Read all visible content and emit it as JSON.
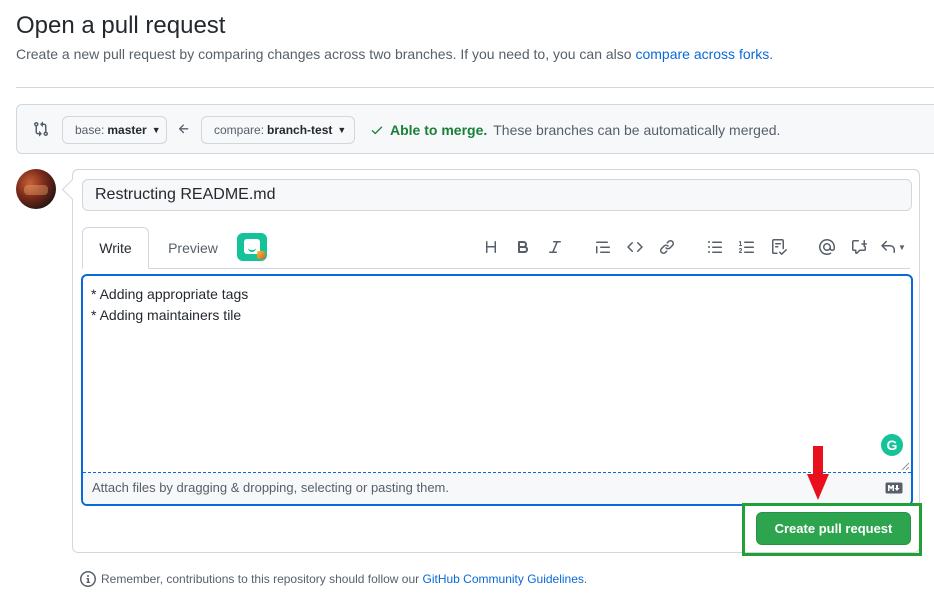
{
  "header": {
    "title": "Open a pull request",
    "subtitle": "Create a new pull request by comparing changes across two branches. If you need to, you can also ",
    "subtitle_link": "compare across forks",
    "subtitle_end": "."
  },
  "range": {
    "base_prefix": "base:",
    "base_branch": "master",
    "compare_prefix": "compare:",
    "compare_branch": "branch-test",
    "merge_ok": "Able to merge.",
    "merge_text": "These branches can be automatically merged."
  },
  "editor": {
    "title_value": "Restructing README.md",
    "tabs": {
      "write": "Write",
      "preview": "Preview"
    },
    "toolbar_icons": [
      "heading-icon",
      "bold-icon",
      "italic-icon",
      "quote-icon",
      "code-icon",
      "link-icon",
      "bullet-list-icon",
      "numbered-list-icon",
      "task-list-icon",
      "mention-icon",
      "reference-icon",
      "reply-icon"
    ],
    "body_value": "* Adding appropriate tags\n* Adding maintainers tile",
    "attach_text": "Attach files by dragging & dropping, selecting or pasting them."
  },
  "actions": {
    "create_label": "Create pull request",
    "button_color": "#2da44e",
    "highlight_color": "#21a038",
    "arrow_color": "#e8101c"
  },
  "footer": {
    "note": "Remember, contributions to this repository should follow our ",
    "link": "GitHub Community Guidelines",
    "end": "."
  }
}
